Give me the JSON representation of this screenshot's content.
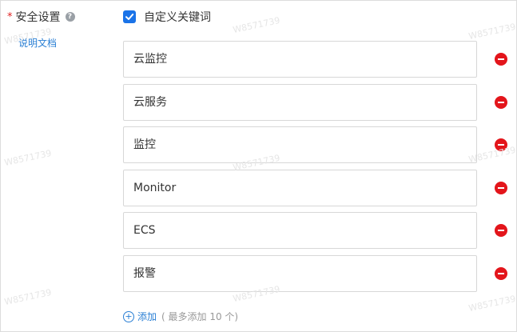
{
  "security": {
    "label": "安全设置",
    "required_mark": "*",
    "help_glyph": "?",
    "doc_link": "说明文档"
  },
  "custom_keywords": {
    "checked": true,
    "label": "自定义关键词",
    "items": [
      "云监控",
      "云服务",
      "监控",
      "Monitor",
      "ECS",
      "报警"
    ]
  },
  "add": {
    "icon_glyph": "+",
    "label": "添加",
    "hint": "( 最多添加 10 个)"
  },
  "watermark": "W8571739",
  "colors": {
    "accent": "#1a73e8",
    "link": "#2a7fd4",
    "remove": "#e3151b"
  }
}
